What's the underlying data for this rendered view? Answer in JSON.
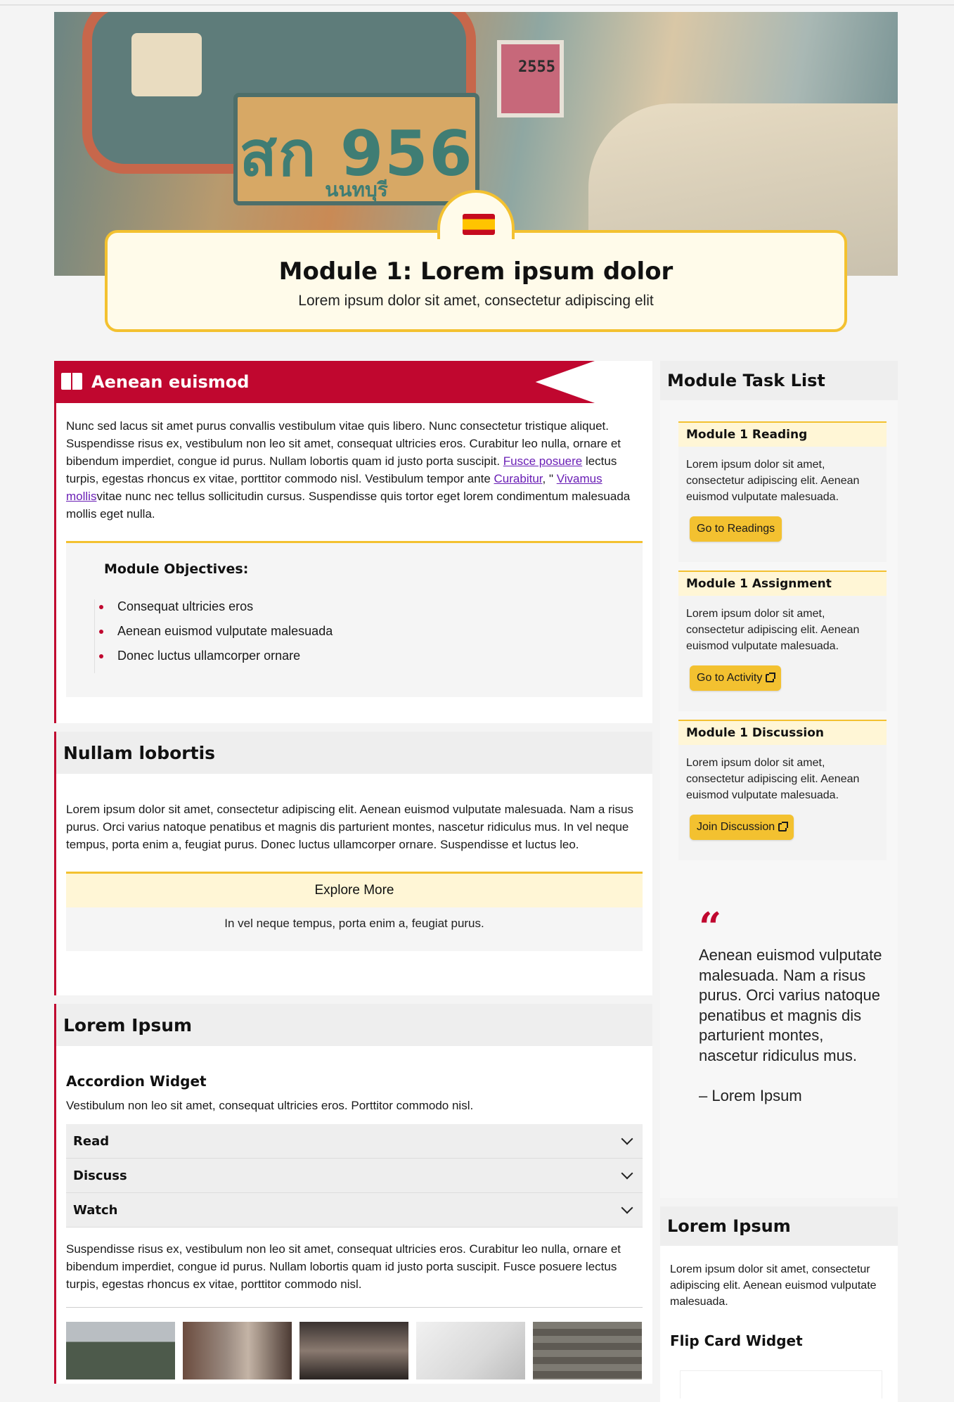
{
  "hero": {
    "plate_text": "สก 956",
    "plate_subtext": "นนทบุรี",
    "sticker_number": "2555"
  },
  "title_card": {
    "title": "Module 1: Lorem ipsum dolor",
    "subtitle": "Lorem ipsum dolor sit amet, consectetur adipiscing elit"
  },
  "section1": {
    "heading": "Aenean euismod",
    "para_part1": "Nunc sed lacus sit amet purus convallis vestibulum vitae quis libero. Nunc consectetur tristique aliquet. Suspendisse risus ex, vestibulum non leo sit amet, consequat ultricies eros. Curabitur leo nulla, ornare et bibendum imperdiet, congue id purus. Nullam lobortis quam id justo porta suscipit. ",
    "link1": "Fusce posuere",
    "para_part2": " lectus turpis, egestas rhoncus ex vitae, porttitor commodo nisl. Vestibulum tempor ante ",
    "link2": "Curabitur",
    "para_part3": ", \" ",
    "link3": "Vivamus mollis",
    "para_part4": "vitae nunc nec tellus sollicitudin cursus. Suspendisse quis tortor eget lorem condimentum malesuada mollis eget nulla.",
    "objectives_title": "Module Objectives:",
    "objectives": [
      "Consequat ultricies eros",
      "Aenean euismod vulputate malesuada",
      "Donec luctus ullamcorper ornare"
    ]
  },
  "section2": {
    "heading": "Nullam lobortis",
    "para": "Lorem ipsum dolor sit amet, consectetur adipiscing elit. Aenean euismod vulputate malesuada. Nam a risus purus. Orci varius natoque penatibus et magnis dis parturient montes, nascetur ridiculus mus. In vel neque tempus, porta enim a, feugiat purus. Donec luctus ullamcorper ornare. Suspendisse et luctus leo.",
    "explore_title": "Explore More",
    "explore_body": "In vel neque tempus, porta enim a, feugiat purus."
  },
  "section3": {
    "heading": "Lorem Ipsum",
    "widget_title": "Accordion Widget",
    "intro": "Vestibulum non leo sit amet, consequat ultricies eros. Porttitor commodo nisl.",
    "accordion": [
      "Read",
      "Discuss",
      "Watch"
    ],
    "after": "Suspendisse risus ex, vestibulum non leo sit amet, consequat ultricies eros. Curabitur leo nulla, ornare et bibendum imperdiet, congue id purus. Nullam lobortis quam id justo porta suscipit. Fusce posuere lectus turpis, egestas rhoncus ex vitae, porttitor commodo nisl."
  },
  "sidebar": {
    "tasklist_title": "Module Task List",
    "tasks": [
      {
        "title": "Module 1 Reading",
        "body": "Lorem ipsum dolor sit amet, consectetur adipiscing elit. Aenean euismod vulputate malesuada.",
        "button": "Go to Readings"
      },
      {
        "title": "Module 1 Assignment",
        "body": "Lorem ipsum dolor sit amet, consectetur adipiscing elit. Aenean euismod vulputate malesuada.",
        "button": "Go to Activity"
      },
      {
        "title": "Module 1 Discussion",
        "body": "Lorem ipsum dolor sit amet, consectetur adipiscing elit. Aenean euismod vulputate malesuada.",
        "button": "Join Discussion"
      }
    ],
    "quote_text": "Aenean euismod vulputate malesuada. Nam a risus purus. Orci varius natoque penatibus et magnis dis parturient montes, nascetur ridiculus mus.",
    "quote_cite": "– Lorem Ipsum",
    "section2_title": "Lorem Ipsum",
    "section2_body": "Lorem ipsum dolor sit amet, consectetur adipiscing elit. Aenean euismod vulputate malesuada.",
    "flip_title": "Flip Card Widget"
  },
  "colors": {
    "accent_red": "#c0072f",
    "accent_yellow": "#f3c130",
    "light_yellow": "#fff6d6"
  }
}
